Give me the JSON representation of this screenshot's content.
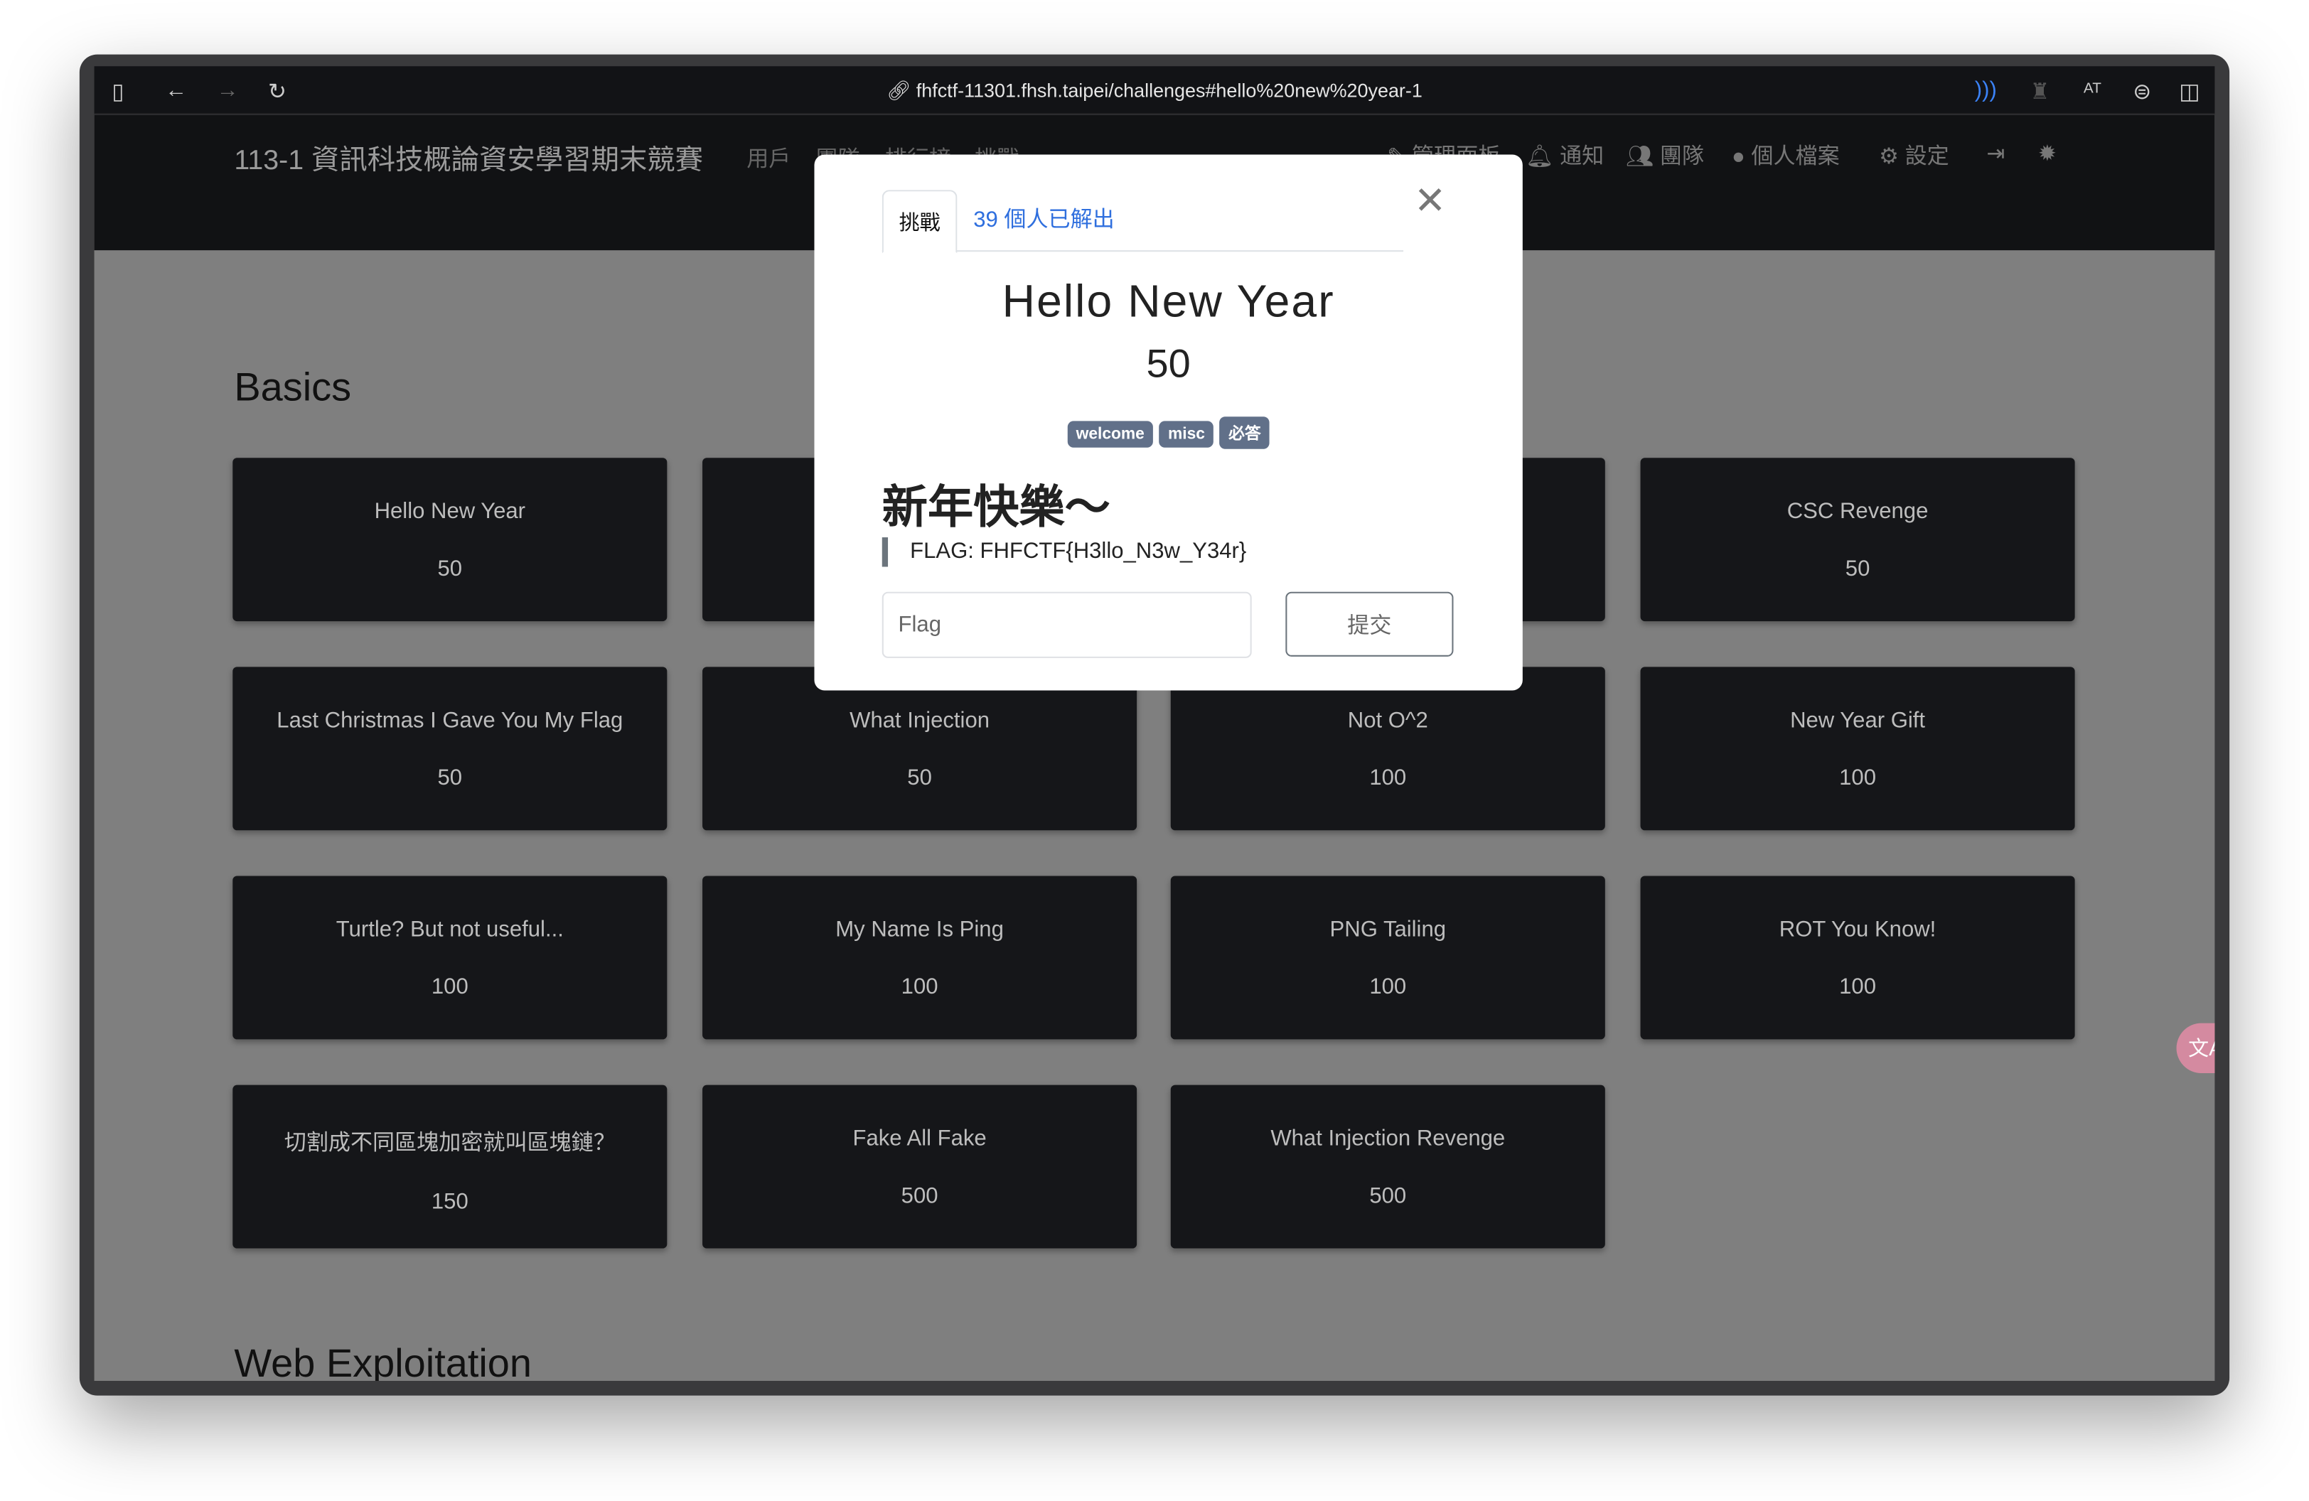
{
  "browser": {
    "url": "fhfctf-11301.fhsh.taipei/challenges#hello%20new%20year-1"
  },
  "nav": {
    "brand": "113-1 資訊科技概論資安學習期末競賽",
    "left": [
      "用戶",
      "團隊",
      "排行榜",
      "挑戰"
    ],
    "right": [
      "管理面板",
      "通知",
      "團隊",
      "個人檔案",
      "設定"
    ]
  },
  "sections": [
    "Basics",
    "Web Exploitation"
  ],
  "cards": [
    {
      "title": "Hello New Year",
      "points": "50"
    },
    {
      "title": "",
      "points": ""
    },
    {
      "title": "",
      "points": ""
    },
    {
      "title": "CSC Revenge",
      "points": "50"
    },
    {
      "title": "Last Christmas I Gave You My Flag",
      "points": "50"
    },
    {
      "title": "What Injection",
      "points": "50"
    },
    {
      "title": "Not O^2",
      "points": "100"
    },
    {
      "title": "New Year Gift",
      "points": "100"
    },
    {
      "title": "Turtle? But not useful...",
      "points": "100"
    },
    {
      "title": "My Name Is Ping",
      "points": "100"
    },
    {
      "title": "PNG Tailing",
      "points": "100"
    },
    {
      "title": "ROT You Know!",
      "points": "100"
    },
    {
      "title": "切割成不同區塊加密就叫區塊鏈？",
      "points": "150"
    },
    {
      "title": "Fake All Fake",
      "points": "500"
    },
    {
      "title": "What Injection Revenge",
      "points": "500"
    }
  ],
  "modal": {
    "tab_challenge": "挑戰",
    "tab_solves": "39 個人已解出",
    "title": "Hello New Year",
    "value": "50",
    "tags": [
      "welcome",
      "misc",
      "必答"
    ],
    "heading": "新年快樂～",
    "flag_text": "FLAG: FHFCTF{H3llo_N3w_Y34r}",
    "input_placeholder": "Flag",
    "submit": "提交"
  },
  "translate_label": "文A"
}
